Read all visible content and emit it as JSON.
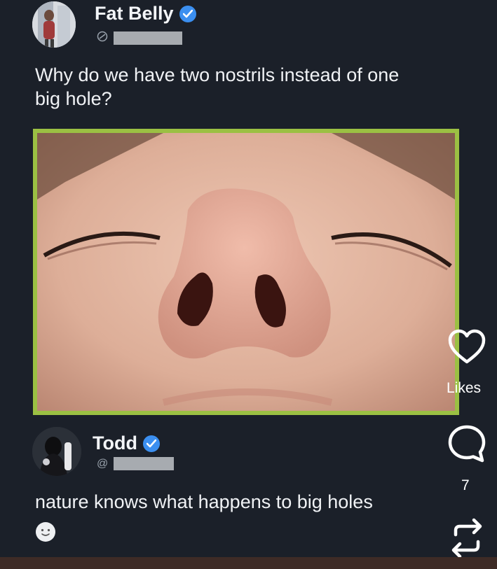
{
  "post": {
    "author_name": "Fat Belly",
    "text": "Why do we have two nostrils instead of one big hole?",
    "image_alt": "Close-up photo looking up at a nose showing two nostrils"
  },
  "reply": {
    "author_name": "Todd",
    "handle_prefix": "@",
    "text": "nature knows what happens to big holes"
  },
  "actions": {
    "likes_label": "Likes",
    "comment_count": "7",
    "icons": [
      "heart-icon",
      "comment-icon",
      "share-icon"
    ]
  },
  "colors": {
    "background": "#1b2029",
    "verified": "#3b8ff0",
    "image_border": "#9bc043"
  }
}
